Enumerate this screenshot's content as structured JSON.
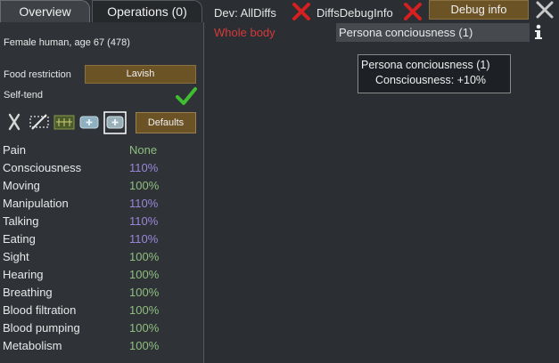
{
  "tabs": {
    "overview": "Overview",
    "operations": "Operations (0)"
  },
  "pawn": {
    "description": "Female human, age 67 (478)"
  },
  "food": {
    "label": "Food restriction",
    "value": "Lavish"
  },
  "self_tend": {
    "label": "Self-tend",
    "checked": true
  },
  "toolbar": {
    "defaults_label": "Defaults",
    "icons": [
      "x-icon",
      "no-medicine-icon",
      "herbal-medicine-icon",
      "industrial-medicine-icon",
      "glitterworld-medicine-icon"
    ]
  },
  "capacities": [
    {
      "name": "Pain",
      "value": "None",
      "color": "#8fbf7f"
    },
    {
      "name": "Consciousness",
      "value": "110%",
      "color": "#9a86d8"
    },
    {
      "name": "Moving",
      "value": "100%",
      "color": "#8fbf7f"
    },
    {
      "name": "Manipulation",
      "value": "110%",
      "color": "#9a86d8"
    },
    {
      "name": "Talking",
      "value": "110%",
      "color": "#9a86d8"
    },
    {
      "name": "Eating",
      "value": "110%",
      "color": "#9a86d8"
    },
    {
      "name": "Sight",
      "value": "100%",
      "color": "#8fbf7f"
    },
    {
      "name": "Hearing",
      "value": "100%",
      "color": "#8fbf7f"
    },
    {
      "name": "Breathing",
      "value": "100%",
      "color": "#8fbf7f"
    },
    {
      "name": "Blood filtration",
      "value": "100%",
      "color": "#8fbf7f"
    },
    {
      "name": "Blood pumping",
      "value": "100%",
      "color": "#8fbf7f"
    },
    {
      "name": "Metabolism",
      "value": "100%",
      "color": "#8fbf7f"
    }
  ],
  "debug": {
    "all_diffs_label": "Dev: AllDiffs",
    "diffs_debug_label": "DiffsDebugInfo",
    "debug_info_button": "Debug info"
  },
  "hediff": {
    "body_part": "Whole body",
    "name": "Persona conciousness (1)"
  },
  "tooltip": {
    "title": "Persona conciousness (1)",
    "line": "Consciousness: +10%"
  },
  "colors": {
    "red_x": "#d42020",
    "check": "#3fbf2f",
    "button": "#6b5326"
  }
}
